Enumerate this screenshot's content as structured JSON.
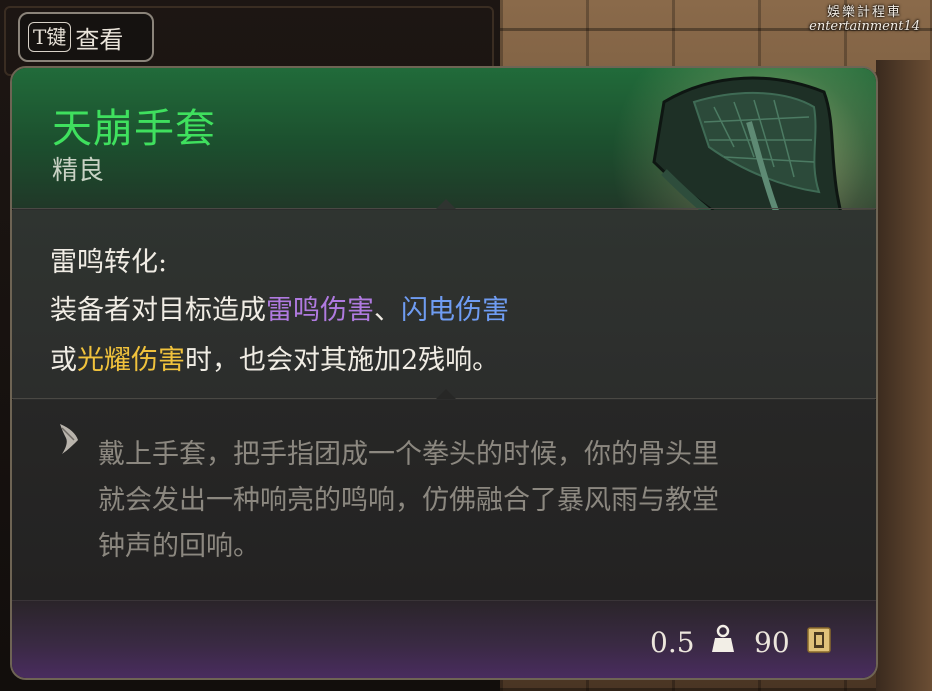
{
  "watermark": {
    "cn": "娛樂計程車",
    "en": "entertainment14"
  },
  "key_hint": {
    "key": "T键",
    "label": "查看"
  },
  "item": {
    "name": "天崩手套",
    "rarity": "精良",
    "name_color": "#3fe05e",
    "rarity_color": "#c9d2c4"
  },
  "effect": {
    "title": "雷鸣转化:",
    "line1_prefix": "装备者对目标造成",
    "thunder_damage": "雷鸣伤害",
    "separator": "、",
    "lightning_damage": "闪电伤害",
    "line2_prefix": "或",
    "radiant_damage": "光耀伤害",
    "line2_suffix": "时，也会对其施加2残响。",
    "colors": {
      "thunder": "#b07ae0",
      "lightning": "#6f9cf2",
      "radiant": "#f0c23c"
    }
  },
  "flavor": {
    "icon": "quill-icon",
    "lines": [
      "戴上手套，把手指团成一个拳头的时候，你的骨头里",
      "就会发出一种响亮的鸣响，仿佛融合了暴风雨与教堂",
      "钟声的回响。"
    ]
  },
  "footer": {
    "weight": "0.5",
    "weight_icon": "weight-icon",
    "price": "90",
    "price_icon": "gold-coin-icon"
  }
}
